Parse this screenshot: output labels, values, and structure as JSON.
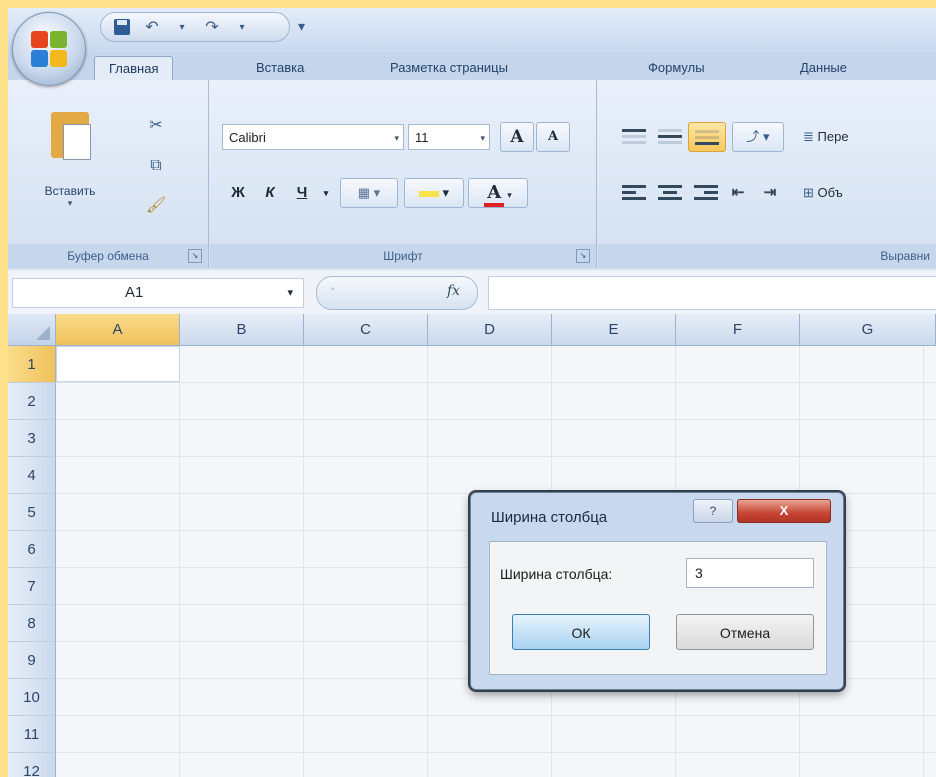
{
  "qat": {
    "icons": [
      "save-icon",
      "undo-icon",
      "redo-icon",
      "customize-icon"
    ]
  },
  "tabs": [
    {
      "label": "Главная",
      "active": true
    },
    {
      "label": "Вставка"
    },
    {
      "label": "Разметка страницы"
    },
    {
      "label": "Формулы"
    },
    {
      "label": "Данные"
    }
  ],
  "ribbon": {
    "clipboard": {
      "paste_label": "Вставить",
      "group_label": "Буфер обмена"
    },
    "font": {
      "name": "Calibri",
      "size": "11",
      "grow": "A",
      "shrink": "A",
      "bold": "Ж",
      "italic": "К",
      "underline": "Ч",
      "group_label": "Шрифт",
      "font_color": "#e02020",
      "fill_color": "#f7e34a"
    },
    "alignment": {
      "wrap_label": "Пере",
      "merge_label": "Объ",
      "group_label": "Выравни"
    }
  },
  "formula_bar": {
    "cell_ref": "A1",
    "fx": "fx",
    "formula": ""
  },
  "sheet": {
    "columns": [
      "A",
      "B",
      "C",
      "D",
      "E",
      "F",
      "G"
    ],
    "rows": [
      "1",
      "2",
      "3",
      "4",
      "5",
      "6",
      "7",
      "8",
      "9",
      "10",
      "11",
      "12"
    ],
    "selected_cell": "A1"
  },
  "dialog": {
    "title": "Ширина столбца",
    "help": "?",
    "close": "X",
    "field_label": "Ширина столбца:",
    "value": "3",
    "ok_label": "ОК",
    "cancel_label": "Отмена"
  }
}
